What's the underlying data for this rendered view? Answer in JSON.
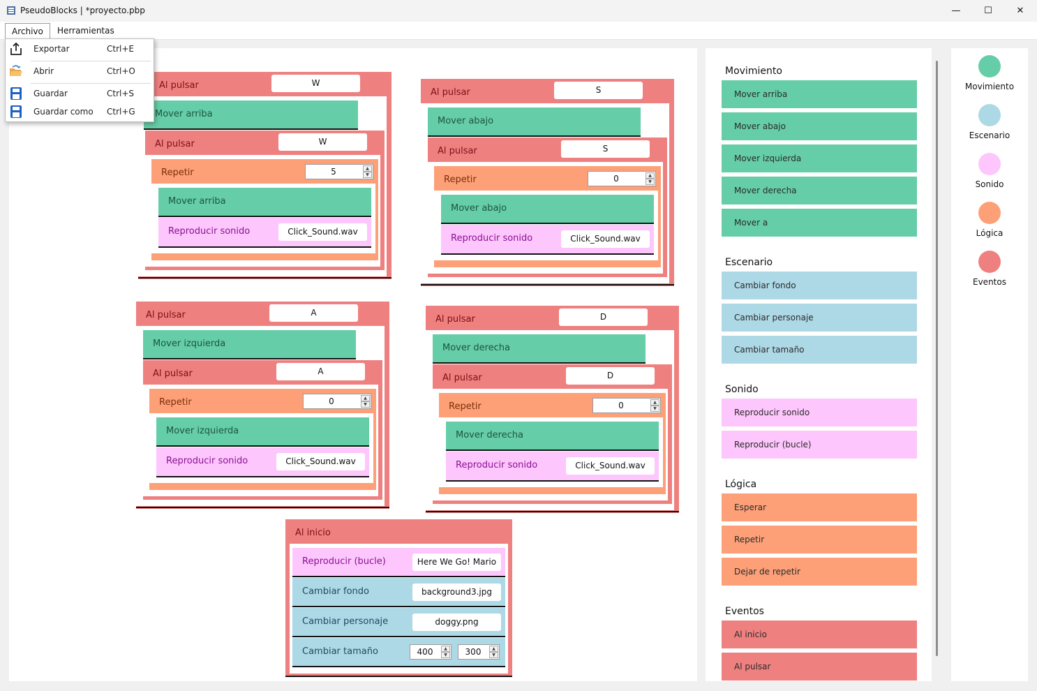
{
  "window": {
    "title": "PseudoBlocks | *proyecto.pbp",
    "minimize": "—",
    "maximize": "☐",
    "close": "✕"
  },
  "menubar": {
    "archivo": "Archivo",
    "herramientas": "Herramientas"
  },
  "file_menu": [
    {
      "label": "Exportar",
      "shortcut": "Ctrl+E",
      "icon": "export-icon"
    },
    {
      "label": "Abrir",
      "shortcut": "Ctrl+O",
      "icon": "open-folder-icon"
    },
    {
      "label": "Guardar",
      "shortcut": "Ctrl+S",
      "icon": "save-icon"
    },
    {
      "label": "Guardar como",
      "shortcut": "Ctrl+G",
      "icon": "save-as-icon"
    }
  ],
  "scripts": [
    {
      "event": "Al pulsar",
      "key": "W",
      "move": "Mover arriba",
      "inner_event": "Al pulsar",
      "inner_key": "W",
      "repeat_label": "Repetir",
      "repeat": "5",
      "inner_move": "Mover arriba",
      "sound": "Reproducir sonido",
      "sound_file": "Click_Sound.wav"
    },
    {
      "event": "Al pulsar",
      "key": "S",
      "move": "Mover abajo",
      "inner_event": "Al pulsar",
      "inner_key": "S",
      "repeat_label": "Repetir",
      "repeat": "0",
      "inner_move": "Mover abajo",
      "sound": "Reproducir sonido",
      "sound_file": "Click_Sound.wav"
    },
    {
      "event": "Al pulsar",
      "key": "A",
      "move": "Mover izquierda",
      "inner_event": "Al pulsar",
      "inner_key": "A",
      "repeat_label": "Repetir",
      "repeat": "0",
      "inner_move": "Mover izquierda",
      "sound": "Reproducir sonido",
      "sound_file": "Click_Sound.wav"
    },
    {
      "event": "Al pulsar",
      "key": "D",
      "move": "Mover derecha",
      "inner_event": "Al pulsar",
      "inner_key": "D",
      "repeat_label": "Repetir",
      "repeat": "0",
      "inner_move": "Mover derecha",
      "sound": "Reproducir sonido",
      "sound_file": "Click_Sound.wav"
    }
  ],
  "start_script": {
    "event": "Al inicio",
    "loop_label": "Reproducir (bucle)",
    "loop_file": "Here We Go! Mario",
    "bg_label": "Cambiar fondo",
    "bg_file": "background3.jpg",
    "char_label": "Cambiar personaje",
    "char_file": "doggy.png",
    "size_label": "Cambiar tamaño",
    "width": "400",
    "height": "300"
  },
  "palette": {
    "movimiento": {
      "title": "Movimiento",
      "blocks": [
        "Mover arriba",
        "Mover abajo",
        "Mover izquierda",
        "Mover derecha",
        "Mover a"
      ]
    },
    "escenario": {
      "title": "Escenario",
      "blocks": [
        "Cambiar fondo",
        "Cambiar personaje",
        "Cambiar tamaño"
      ]
    },
    "sonido": {
      "title": "Sonido",
      "blocks": [
        "Reproducir sonido",
        "Reproducir (bucle)"
      ]
    },
    "logica": {
      "title": "Lógica",
      "blocks": [
        "Esperar",
        "Repetir",
        "Dejar de repetir"
      ]
    },
    "eventos": {
      "title": "Eventos",
      "blocks": [
        "Al inicio",
        "Al pulsar"
      ]
    }
  },
  "categories": [
    {
      "label": "Movimiento",
      "color": "#66cda9"
    },
    {
      "label": "Escenario",
      "color": "#add8e6"
    },
    {
      "label": "Sonido",
      "color": "#fdc6fc"
    },
    {
      "label": "Lógica",
      "color": "#fda078"
    },
    {
      "label": "Eventos",
      "color": "#ef8080"
    }
  ],
  "colors": {
    "eventos": "#ef8080",
    "movimiento": "#66cda9",
    "logica": "#fda078",
    "sonido": "#fdc6fc",
    "escenario": "#add8e6"
  }
}
